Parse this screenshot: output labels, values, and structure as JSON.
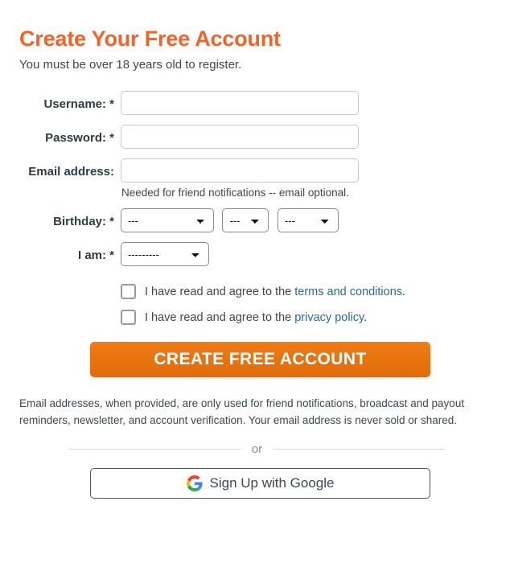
{
  "heading": "Create Your Free Account",
  "subheading": "You must be over 18 years old to register.",
  "colors": {
    "heading": "#f4622a",
    "link": "#2b6c8f",
    "button": "#e06b0a",
    "text": "#3d4852"
  },
  "fields": {
    "username": {
      "label": "Username: *",
      "value": "",
      "placeholder": ""
    },
    "password": {
      "label": "Password: *",
      "value": "",
      "placeholder": ""
    },
    "email": {
      "label": "Email address:",
      "value": "",
      "placeholder": "",
      "help": "Needed for friend notifications -- email optional."
    },
    "birthday": {
      "label": "Birthday: *",
      "month": "---",
      "day": "---",
      "year": "---"
    },
    "iam": {
      "label": "I am: *",
      "value": "---------"
    }
  },
  "checkboxes": [
    {
      "text_before": "I have read and agree to the ",
      "link_text": "terms and conditions",
      "text_after": ".",
      "checked": false
    },
    {
      "text_before": "I have read and agree to the ",
      "link_text": "privacy policy",
      "text_after": ".",
      "checked": false
    }
  ],
  "submit_label": "CREATE FREE ACCOUNT",
  "disclaimer": "Email addresses, when provided, are only used for friend notifications, broadcast and payout reminders, newsletter, and account verification. Your email address is never sold or shared.",
  "divider_text": "or",
  "google_button": {
    "label": "Sign Up with Google",
    "icon": "google-g-icon"
  }
}
